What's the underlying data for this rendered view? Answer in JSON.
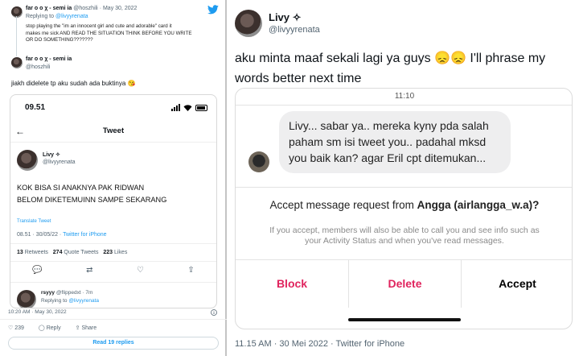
{
  "left": {
    "reply_tweet": {
      "name": "far o o χ - semi ia",
      "handle": "@hoszhili",
      "date": "May 30, 2022",
      "replying_to_prefix": "Replying to",
      "replying_to": "@livyyrenata",
      "text_line1": "stop playing the \"im an innocent girl and cute and adorable\" card it",
      "text_line2": "makes me sick AND READ THE SITUATION THINK BEFORE YOU WRITE",
      "text_line3": "OR DO SOMETHING???????"
    },
    "main_tweet": {
      "name": "far o o χ - semi ia",
      "handle": "@hoszhili",
      "text": "jiakh didelete tp aku sudah ada buktinya",
      "emoji": "😘"
    },
    "phone": {
      "time": "09.51",
      "header_title": "Tweet",
      "user_name": "Livy ✧",
      "user_handle": "@livyyrenata",
      "tweet_line1": "KOK BISA SI ANAKNYA PAK RIDWAN",
      "tweet_line2": "BELOM DIKETEMUINN SAMPE SEKARANG",
      "translate": "Translate Tweet",
      "timestamp": "08.51 · 30/05/22 ·",
      "source": "Twitter for iPhone",
      "retweets_count": "13",
      "retweets_label": "Retweets",
      "quotes_count": "274",
      "quotes_label": "Quote Tweets",
      "likes_count": "223",
      "likes_label": "Likes",
      "reply_user": "rsyyy",
      "reply_handle": "@flippedxt · 7m",
      "reply_prefix": "Replying to",
      "reply_to": "@livyyrenata"
    },
    "footer": {
      "timestamp": "10:20 AM · May 30, 2022",
      "likes": "239",
      "reply_label": "Reply",
      "share_label": "Share",
      "read_replies": "Read 19 replies"
    }
  },
  "right": {
    "name": "Livy ✧",
    "handle": "@livyyrenata",
    "tweet_line1": "aku minta maaf sekali lagi ya guys 😞😞 I'll phrase my",
    "tweet_line2": "words better next time",
    "dm": {
      "time": "11:10",
      "bubble_line1": "Livy... sabar ya.. mereka kyny pda salah",
      "bubble_line2": "paham sm isi tweet you.. padahal mksd",
      "bubble_line3": "you baik kan? agar Eril cpt ditemukan...",
      "request_prefix": "Accept message request from",
      "request_name": "Angga (airlangga_w.a)?",
      "info_line1": "If you accept, members will also be able to call you and see info such as",
      "info_line2": "your Activity Status and when you've read messages.",
      "block_label": "Block",
      "delete_label": "Delete",
      "accept_label": "Accept"
    },
    "footer": "11.15 AM · 30 Mei 2022 · Twitter for iPhone"
  },
  "colors": {
    "twitter_blue": "#1d9bf0",
    "danger_red": "#e0245e",
    "muted": "#536471"
  }
}
